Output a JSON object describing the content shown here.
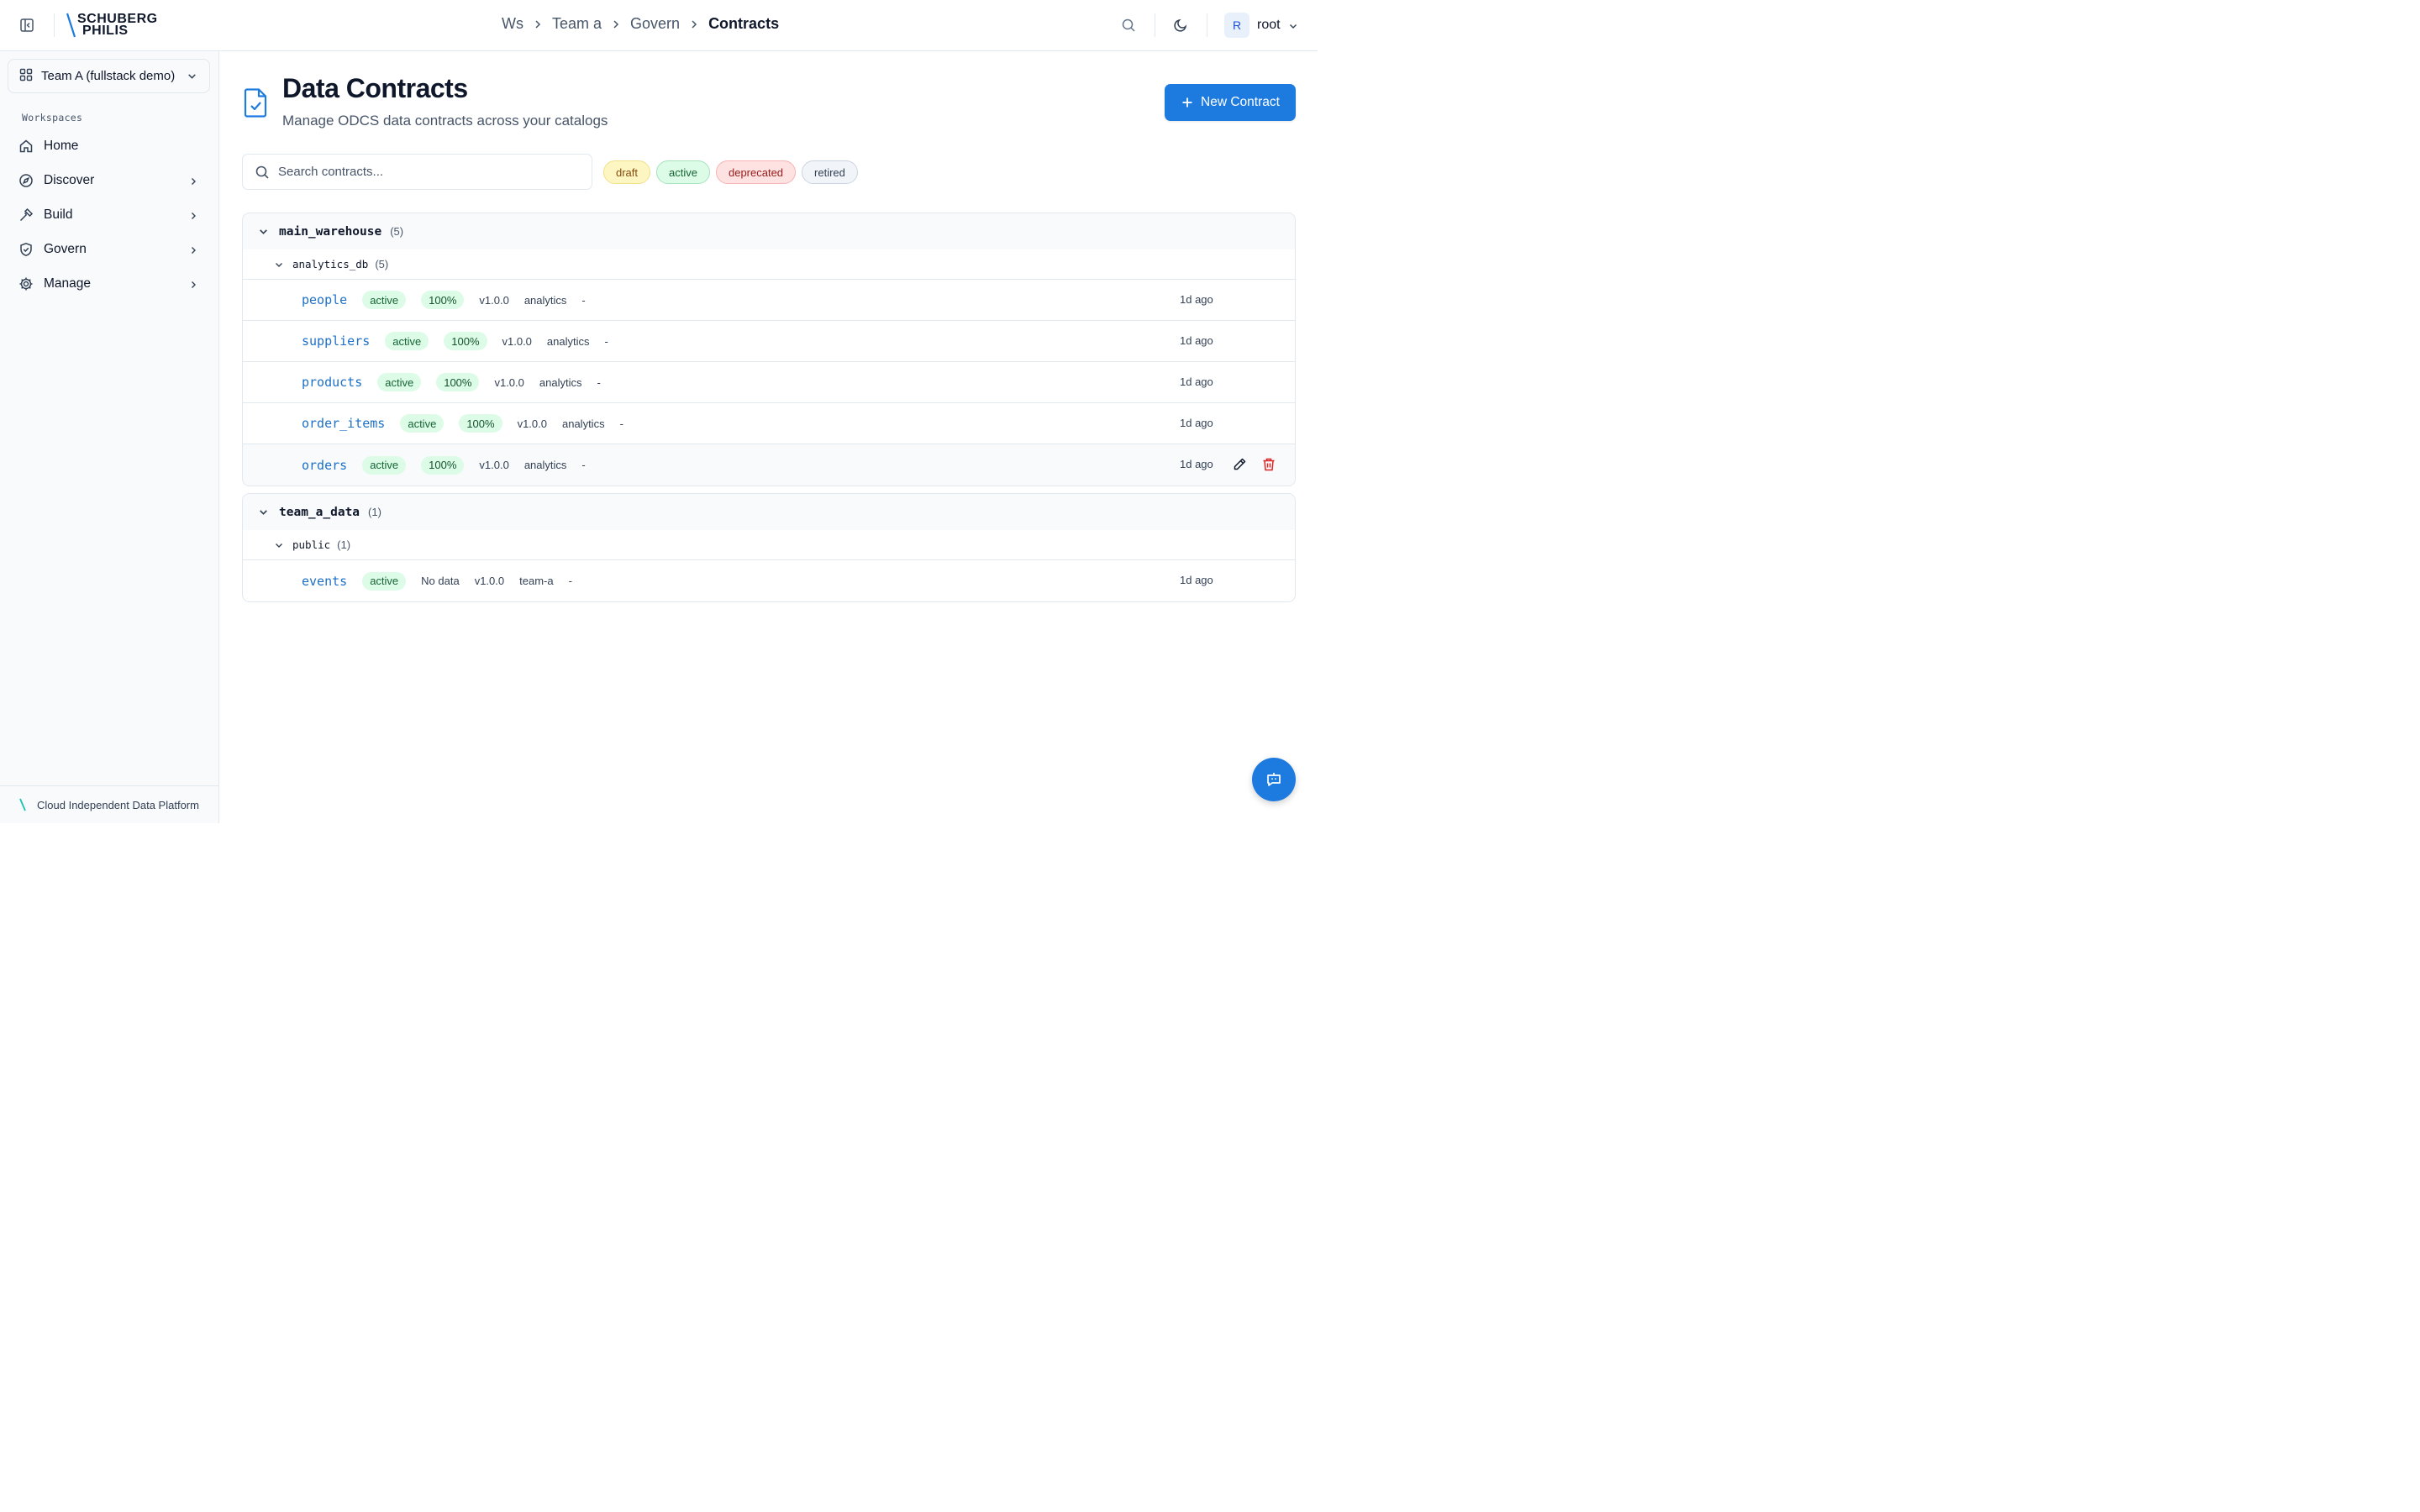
{
  "brand": {
    "line1": "SCHUBERG",
    "line2": "PHILIS",
    "accent": "#17c3b2"
  },
  "breadcrumb": [
    {
      "label": "Ws"
    },
    {
      "label": "Team a"
    },
    {
      "label": "Govern"
    },
    {
      "label": "Contracts"
    }
  ],
  "user": {
    "initial": "R",
    "name": "root"
  },
  "sidebar": {
    "team": "Team A (fullstack demo)",
    "section_label": "Workspaces",
    "items": [
      {
        "label": "Home",
        "icon": "home-icon",
        "expandable": false
      },
      {
        "label": "Discover",
        "icon": "compass-icon",
        "expandable": true
      },
      {
        "label": "Build",
        "icon": "hammer-icon",
        "expandable": true
      },
      {
        "label": "Govern",
        "icon": "shield-check-icon",
        "expandable": true
      },
      {
        "label": "Manage",
        "icon": "gear-icon",
        "expandable": true
      }
    ],
    "footer": "Cloud Independent Data Platform"
  },
  "page": {
    "title": "Data Contracts",
    "subtitle": "Manage ODCS data contracts across your catalogs",
    "new_button": "New Contract"
  },
  "search": {
    "placeholder": "Search contracts..."
  },
  "filters": [
    "draft",
    "active",
    "deprecated",
    "retired"
  ],
  "catalogs": [
    {
      "name": "main_warehouse",
      "count": "(5)",
      "schemas": [
        {
          "name": "analytics_db",
          "count": "(5)",
          "contracts": [
            {
              "name": "people",
              "status": "active",
              "coverage": "100%",
              "version": "v1.0.0",
              "owner": "analytics",
              "extra": "-",
              "age": "1d ago"
            },
            {
              "name": "suppliers",
              "status": "active",
              "coverage": "100%",
              "version": "v1.0.0",
              "owner": "analytics",
              "extra": "-",
              "age": "1d ago"
            },
            {
              "name": "products",
              "status": "active",
              "coverage": "100%",
              "version": "v1.0.0",
              "owner": "analytics",
              "extra": "-",
              "age": "1d ago"
            },
            {
              "name": "order_items",
              "status": "active",
              "coverage": "100%",
              "version": "v1.0.0",
              "owner": "analytics",
              "extra": "-",
              "age": "1d ago"
            },
            {
              "name": "orders",
              "status": "active",
              "coverage": "100%",
              "version": "v1.0.0",
              "owner": "analytics",
              "extra": "-",
              "age": "1d ago"
            }
          ]
        }
      ]
    },
    {
      "name": "team_a_data",
      "count": "(1)",
      "schemas": [
        {
          "name": "public",
          "count": "(1)",
          "contracts": [
            {
              "name": "events",
              "status": "active",
              "coverage": "No data",
              "version": "v1.0.0",
              "owner": "team-a",
              "extra": "-",
              "age": "1d ago"
            }
          ]
        }
      ]
    }
  ],
  "colors": {
    "primary": "#1d7be0",
    "link": "#1d70c8",
    "danger": "#dc2626"
  }
}
